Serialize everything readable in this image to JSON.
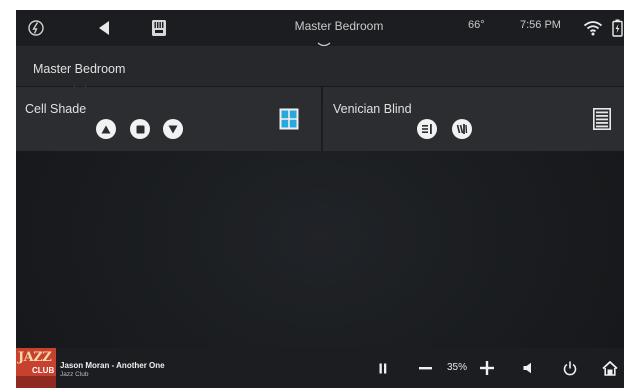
{
  "topbar": {
    "room_title": "Master Bedroom",
    "temperature": "66°",
    "time": "7:56 PM",
    "icons": [
      "logo-icon",
      "back-icon",
      "remote-icon",
      "wifi-icon",
      "battery-icon"
    ]
  },
  "room_selector": {
    "label": "Master Bedroom"
  },
  "shades": [
    {
      "label": "Cell Shade",
      "controls": [
        "up",
        "stop",
        "down"
      ],
      "icon": "window-icon"
    },
    {
      "label": "Venician Blind",
      "controls": [
        "open-slats",
        "close-slats"
      ],
      "icon": "blind-icon"
    }
  ],
  "now_playing": {
    "album_art_text_top": "JAZZ",
    "album_art_text_bottom": "CLUB",
    "track": "Jason Moran - Another One",
    "source": "Jazz Club",
    "volume": "35%"
  },
  "colors": {
    "background": "#17191c",
    "bar": "#1b1d20",
    "tile": "#2b2d31",
    "accent_blue": "#29a8e0",
    "album_red": "#c8402e"
  }
}
